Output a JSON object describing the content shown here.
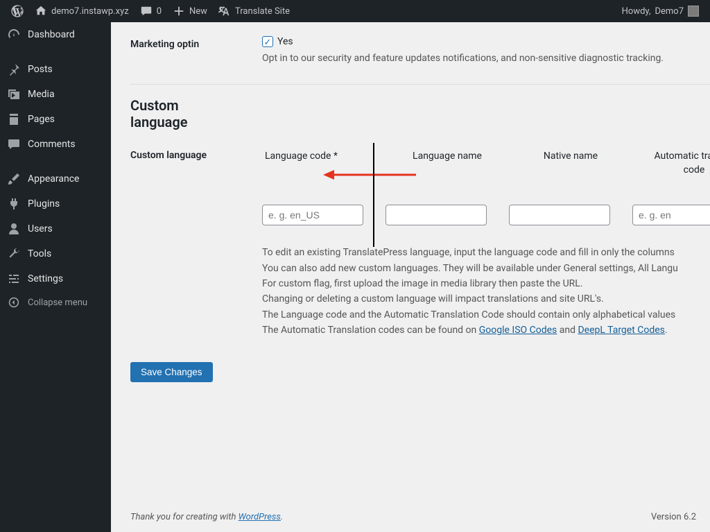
{
  "adminbar": {
    "site_name": "demo7.instawp.xyz",
    "comments_count": "0",
    "new_label": "New",
    "translate_label": "Translate Site",
    "howdy_prefix": "Howdy, ",
    "user_name": "Demo7"
  },
  "sidebar": {
    "items": [
      {
        "icon": "dashboard",
        "label": "Dashboard"
      },
      {
        "icon": "pin",
        "label": "Posts"
      },
      {
        "icon": "media",
        "label": "Media"
      },
      {
        "icon": "page",
        "label": "Pages"
      },
      {
        "icon": "comment",
        "label": "Comments"
      },
      {
        "icon": "brush",
        "label": "Appearance"
      },
      {
        "icon": "plug",
        "label": "Plugins"
      },
      {
        "icon": "user",
        "label": "Users"
      },
      {
        "icon": "wrench",
        "label": "Tools"
      },
      {
        "icon": "sliders",
        "label": "Settings"
      }
    ],
    "collapse_label": "Collapse menu"
  },
  "marketing": {
    "row_label": "Marketing optin",
    "checkbox_label": "Yes",
    "checked": true,
    "description": "Opt in to our security and feature updates notifications, and non-sensitive diagnostic tracking."
  },
  "custom_lang": {
    "section_title": "Custom language",
    "row_label": "Custom language",
    "headers": {
      "code": "Language code *",
      "name": "Language name",
      "native": "Native name",
      "auto": "Automatic translation code"
    },
    "placeholders": {
      "code": "e. g. en_US",
      "name": "",
      "native": "",
      "auto": "e. g. en"
    },
    "notes": {
      "l1": "To edit an existing TranslatePress language, input the language code and fill in only the columns",
      "l2": "You can also add new custom languages. They will be available under General settings, All Langu",
      "l3": "For custom flag, first upload the image in media library then paste the URL.",
      "l4": "Changing or deleting a custom language will impact translations and site URL's.",
      "l5": "The Language code and the Automatic Translation Code should contain only alphabetical values",
      "l6_pre": "The Automatic Translation codes can be found on ",
      "l6_link1": "Google ISO Codes",
      "l6_mid": " and ",
      "l6_link2": "DeepL Target Codes",
      "l6_post": "."
    }
  },
  "save_label": "Save Changes",
  "footer": {
    "thanks_pre": "Thank you for creating with ",
    "thanks_link": "WordPress",
    "thanks_post": ".",
    "version": "Version 6.2"
  }
}
